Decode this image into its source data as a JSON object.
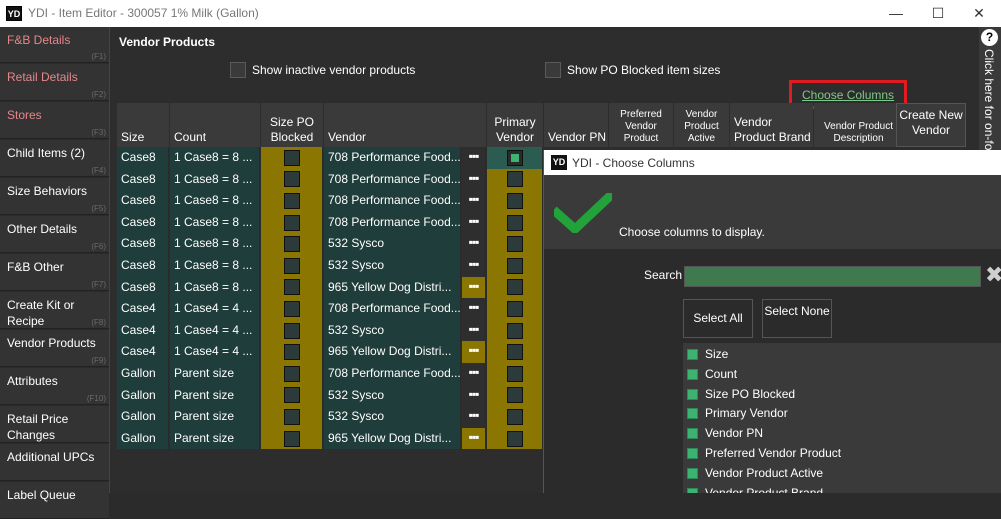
{
  "window": {
    "title": "YDI - Item Editor - 300057 1% Milk (Gallon)",
    "icon_text": "YD",
    "minimize": "—",
    "maximize": "☐",
    "close": "✕"
  },
  "sidebar": {
    "items": [
      {
        "label": "F&B Details",
        "fkey": "(F1)"
      },
      {
        "label": "Retail Details",
        "fkey": "(F2)"
      },
      {
        "label": "Stores",
        "fkey": "(F3)"
      },
      {
        "label": "Child Items (2)",
        "fkey": "(F4)"
      },
      {
        "label": "Size Behaviors",
        "fkey": "(F5)"
      },
      {
        "label": "Other Details",
        "fkey": "(F6)"
      },
      {
        "label": "F&B Other",
        "fkey": "(F7)"
      },
      {
        "label": "Create Kit or Recipe",
        "fkey": "(F8)"
      },
      {
        "label": "Vendor Products",
        "fkey": "(F9)"
      },
      {
        "label": "Attributes",
        "fkey": "(F10)"
      },
      {
        "label": "Retail Price Changes",
        "fkey": ""
      },
      {
        "label": "Additional UPCs",
        "fkey": ""
      },
      {
        "label": "Label Queue",
        "fkey": ""
      }
    ]
  },
  "main": {
    "heading": "Vendor Products",
    "show_inactive_label": "Show inactive vendor products",
    "show_blocked_label": "Show PO Blocked item sizes",
    "choose_columns_link": "Choose Columns",
    "create_new_vendor": "Create New Vendor",
    "help_icon_text": "?",
    "side_tab_text": "Click here for on-fo"
  },
  "grid": {
    "headers": {
      "size": "Size",
      "count": "Count",
      "size_po_blocked": "Size PO Blocked",
      "vendor": "Vendor",
      "primary_vendor": "Primary Vendor",
      "vendor_pn": "Vendor PN",
      "preferred_vendor_product": "Preferred Vendor Product",
      "vendor_product_active": "Vendor Product Active",
      "vendor_product_brand": "Vendor Product Brand",
      "vendor_product_description": "Vendor Product Description"
    },
    "more_glyph": "▪▪▪",
    "rows": [
      {
        "size": "Case8",
        "count": "1 Case8 = 8 ...",
        "vendor": "708 Performance Food...",
        "primary": true
      },
      {
        "size": "Case8",
        "count": "1 Case8 = 8 ...",
        "vendor": "708 Performance Food...",
        "primary": false
      },
      {
        "size": "Case8",
        "count": "1 Case8 = 8 ...",
        "vendor": "708 Performance Food...",
        "primary": false
      },
      {
        "size": "Case8",
        "count": "1 Case8 = 8 ...",
        "vendor": "708 Performance Food...",
        "primary": false
      },
      {
        "size": "Case8",
        "count": "1 Case8 = 8 ...",
        "vendor": "532 Sysco",
        "primary": false
      },
      {
        "size": "Case8",
        "count": "1 Case8 = 8 ...",
        "vendor": "532 Sysco",
        "primary": false
      },
      {
        "size": "Case8",
        "count": "1 Case8 = 8 ...",
        "vendor": "965 Yellow Dog Distri...",
        "primary": false
      },
      {
        "size": "Case4",
        "count": "1 Case4 = 4 ...",
        "vendor": "708 Performance Food...",
        "primary": false
      },
      {
        "size": "Case4",
        "count": "1 Case4 = 4 ...",
        "vendor": "532 Sysco",
        "primary": false
      },
      {
        "size": "Case4",
        "count": "1 Case4 = 4 ...",
        "vendor": "965 Yellow Dog Distri...",
        "primary": false
      },
      {
        "size": "Gallon",
        "count": "Parent size",
        "vendor": "708 Performance Food...",
        "primary": false
      },
      {
        "size": "Gallon",
        "count": "Parent size",
        "vendor": "532 Sysco",
        "primary": false
      },
      {
        "size": "Gallon",
        "count": "Parent size",
        "vendor": "532 Sysco",
        "primary": false
      },
      {
        "size": "Gallon",
        "count": "Parent size",
        "vendor": "965 Yellow Dog Distri...",
        "primary": false
      }
    ]
  },
  "dialog": {
    "title": "YDI - Choose Columns",
    "icon_text": "YD",
    "message": "Choose columns to display.",
    "search_label": "Search",
    "search_value": "",
    "clear_glyph": "✖",
    "select_all": "Select All",
    "select_none": "Select None",
    "columns": [
      {
        "label": "Size",
        "checked": true
      },
      {
        "label": "Count",
        "checked": true
      },
      {
        "label": "Size PO Blocked",
        "checked": true
      },
      {
        "label": "Primary Vendor",
        "checked": true
      },
      {
        "label": "Vendor PN",
        "checked": true
      },
      {
        "label": "Preferred Vendor Product",
        "checked": true
      },
      {
        "label": "Vendor Product Active",
        "checked": true
      },
      {
        "label": "Vendor Product Brand",
        "checked": true
      }
    ]
  },
  "colors": {
    "accent_green": "#3cb371",
    "gold": "#8a7600",
    "highlight_red": "#e01b22",
    "link_green": "#7ec88a"
  }
}
